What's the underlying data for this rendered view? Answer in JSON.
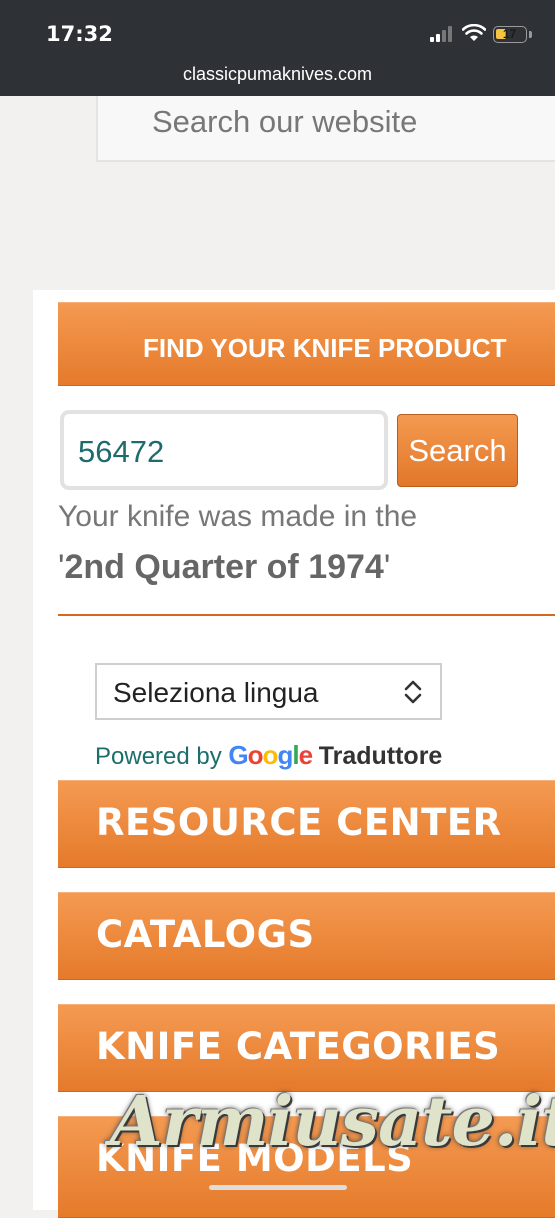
{
  "status": {
    "time": "17:32",
    "battery": "17",
    "url": "classicpumaknives.com"
  },
  "site_search": {
    "placeholder": "Search our website"
  },
  "finder": {
    "title": "FIND YOUR KNIFE PRODUCT",
    "input_value": "56472",
    "button_label": "Search",
    "result_line1": "Your knife was made in the",
    "result_quote_open": "'",
    "result_value": "2nd Quarter of 1974",
    "result_quote_close": "'"
  },
  "translate": {
    "select_label": "Seleziona lingua",
    "powered_by": "Powered by",
    "google": "Google",
    "product": "Traduttore"
  },
  "nav": {
    "resource_center": "RESOURCE CENTER",
    "catalogs": "CATALOGS",
    "knife_categories": "KNIFE CATEGORIES",
    "knife_models": "KNIFE MODELS"
  },
  "watermark": "Armiusate.it",
  "colors": {
    "accent": "#e8802f",
    "status_bg": "#2e3236",
    "teal": "#1c6e6c"
  }
}
